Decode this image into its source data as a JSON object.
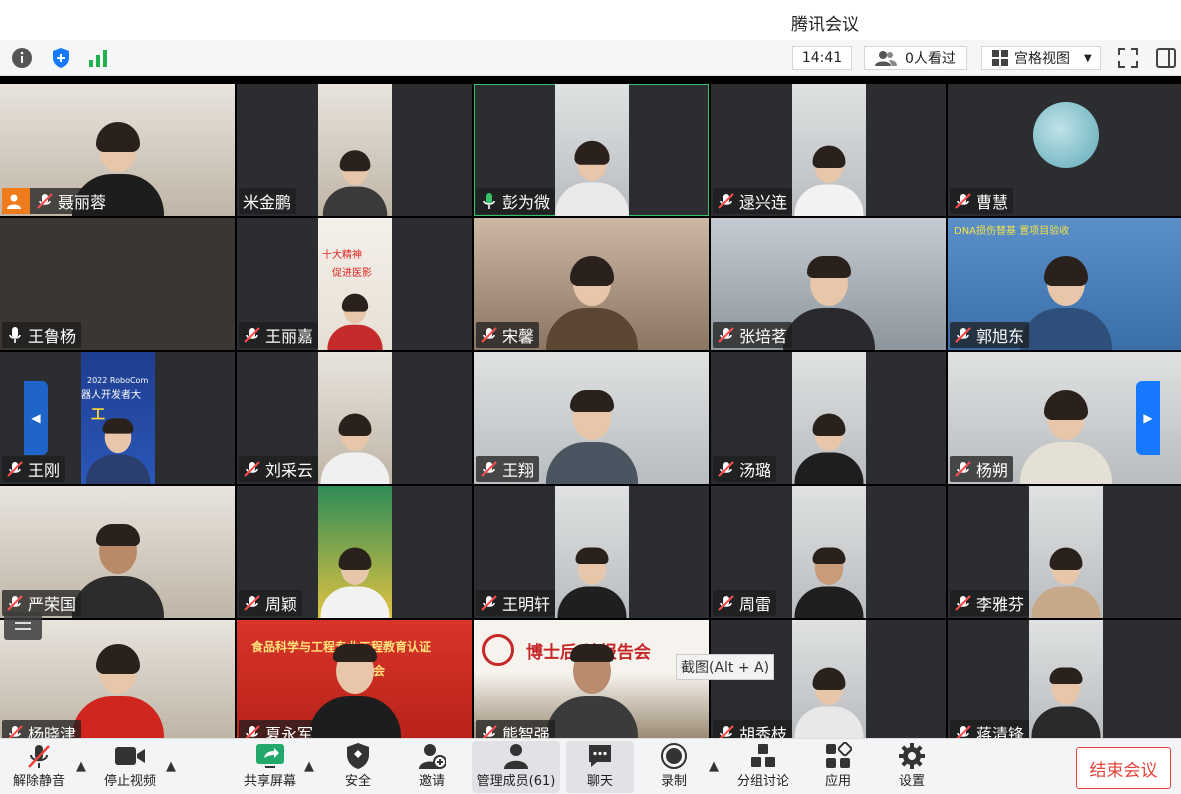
{
  "app": {
    "title": "腾讯会议"
  },
  "topbar": {
    "time": "14:41",
    "viewers": "0人看过",
    "view_mode": "宫格视图"
  },
  "participants": [
    {
      "name": "聂丽蓉",
      "mic": "muted",
      "host": true
    },
    {
      "name": "米金鹏",
      "mic": "none"
    },
    {
      "name": "彭为微",
      "mic": "on",
      "speaking": true
    },
    {
      "name": "逯兴连",
      "mic": "muted"
    },
    {
      "name": "曹慧",
      "mic": "muted"
    },
    {
      "name": "王鲁杨",
      "mic": "on"
    },
    {
      "name": "王丽嘉",
      "mic": "muted"
    },
    {
      "name": "宋馨",
      "mic": "muted"
    },
    {
      "name": "张培茗",
      "mic": "muted"
    },
    {
      "name": "郭旭东",
      "mic": "muted"
    },
    {
      "name": "王刚",
      "mic": "muted"
    },
    {
      "name": "刘采云",
      "mic": "muted"
    },
    {
      "name": "王翔",
      "mic": "muted"
    },
    {
      "name": "汤璐",
      "mic": "muted"
    },
    {
      "name": "杨朔",
      "mic": "muted"
    },
    {
      "name": "严荣国",
      "mic": "muted"
    },
    {
      "name": "周颖",
      "mic": "muted"
    },
    {
      "name": "王明轩",
      "mic": "muted"
    },
    {
      "name": "周雷",
      "mic": "muted"
    },
    {
      "name": "李雅芬",
      "mic": "muted"
    },
    {
      "name": "杨晓津",
      "mic": "muted"
    },
    {
      "name": "夏永军",
      "mic": "muted"
    },
    {
      "name": "熊智强",
      "mic": "muted"
    },
    {
      "name": "胡秀枝",
      "mic": "muted"
    },
    {
      "name": "蒋清锋",
      "mic": "muted"
    }
  ],
  "video_captions": {
    "robocom_1": "2022 RoboCom",
    "robocom_2": "器人开发者大",
    "robocom_3": "工",
    "wang_lijia_poster_1": "十大精神",
    "wang_lijia_poster_2": "促进医影",
    "guo_banner": "DNA损伤替基   置项目验收",
    "food_banner_1": "食品科学与工程专业工程教育认证",
    "food_banner_2": "谈会",
    "phd_banner": "博士后  站报告会"
  },
  "tooltip": "截图(Alt + A)",
  "toolbar": {
    "unmute": "解除静音",
    "stop_video": "停止视频",
    "share_screen": "共享屏幕",
    "security": "安全",
    "invite": "邀请",
    "manage_members": "管理成员(61)",
    "chat": "聊天",
    "record": "录制",
    "breakout": "分组讨论",
    "apps": "应用",
    "settings": "设置",
    "end_meeting": "结束会议"
  },
  "colors": {
    "accent_green": "#36c26b",
    "host_orange": "#f07b1c",
    "end_red": "#e5433b",
    "pager_blue": "#1677ff"
  }
}
